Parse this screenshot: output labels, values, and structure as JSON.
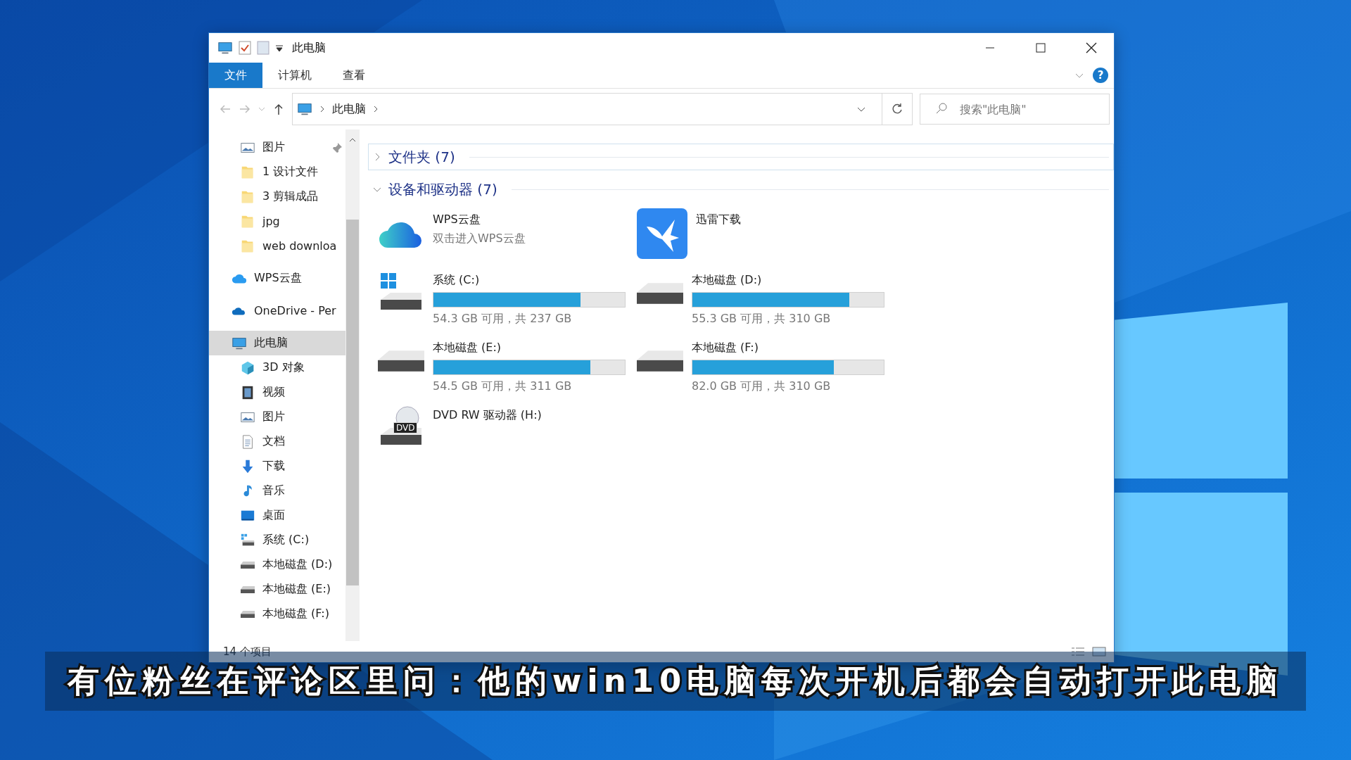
{
  "window": {
    "title": "此电脑"
  },
  "ribbon": {
    "tabs": [
      {
        "label": "文件",
        "selected": true
      },
      {
        "label": "计算机",
        "selected": false
      },
      {
        "label": "查看",
        "selected": false
      }
    ],
    "help": "?"
  },
  "address_bar": {
    "path": [
      "此电脑"
    ],
    "search_placeholder": "搜索\"此电脑\""
  },
  "sidebar": {
    "quick_access": [
      {
        "kind": "pictures",
        "label": "图片",
        "pinned": true,
        "selected": false
      },
      {
        "kind": "folder",
        "label": "1 设计文件",
        "pinned": false,
        "selected": false
      },
      {
        "kind": "folder",
        "label": "3 剪辑成品",
        "pinned": false,
        "selected": false
      },
      {
        "kind": "folder",
        "label": "jpg",
        "pinned": false,
        "selected": false
      },
      {
        "kind": "folder",
        "label": "web downloa",
        "pinned": false,
        "selected": false
      }
    ],
    "items": [
      {
        "kind": "wps",
        "label": "WPS云盘",
        "selected": false
      },
      {
        "kind": "onedrive",
        "label": "OneDrive - Per",
        "selected": false
      },
      {
        "kind": "pc",
        "label": "此电脑",
        "selected": true,
        "children": [
          {
            "kind": "cube",
            "label": "3D 对象",
            "selected": false
          },
          {
            "kind": "video",
            "label": "视频",
            "selected": false
          },
          {
            "kind": "pictures",
            "label": "图片",
            "selected": false
          },
          {
            "kind": "docs",
            "label": "文档",
            "selected": false
          },
          {
            "kind": "download",
            "label": "下载",
            "selected": false
          },
          {
            "kind": "music",
            "label": "音乐",
            "selected": false
          },
          {
            "kind": "desktop",
            "label": "桌面",
            "selected": false
          },
          {
            "kind": "sysdrive",
            "label": "系统 (C:)",
            "selected": false
          },
          {
            "kind": "drive",
            "label": "本地磁盘 (D:)",
            "selected": false
          },
          {
            "kind": "drive",
            "label": "本地磁盘 (E:)",
            "selected": false
          },
          {
            "kind": "drive",
            "label": "本地磁盘 (F:)",
            "selected": false
          }
        ]
      }
    ]
  },
  "sections": [
    {
      "title": "文件夹 (7)",
      "expanded": false
    },
    {
      "title": "设备和驱动器 (7)",
      "expanded": true,
      "items": [
        {
          "kind": "wps",
          "name": "WPS云盘",
          "subtitle": "双击进入WPS云盘"
        },
        {
          "kind": "xunlei",
          "name": "迅雷下载"
        },
        {
          "kind": "system-drive",
          "name": "系统 (C:)",
          "level": 0.77,
          "reading": "54.3 GB 可用，共 237 GB"
        },
        {
          "kind": "drive",
          "name": "本地磁盘 (D:)",
          "level": 0.82,
          "reading": "55.3 GB 可用，共 310 GB"
        },
        {
          "kind": "drive",
          "name": "本地磁盘 (E:)",
          "level": 0.82,
          "reading": "54.5 GB 可用，共 311 GB"
        },
        {
          "kind": "drive",
          "name": "本地磁盘 (F:)",
          "level": 0.74,
          "reading": "82.0 GB 可用，共 310 GB"
        },
        {
          "kind": "dvd",
          "name": "DVD RW 驱动器 (H:)",
          "badge": "DVD"
        }
      ]
    }
  ],
  "status_bar": {
    "count": "14 个项目"
  },
  "caption": "有位粉丝在评论区里问：他的win10电脑每次开机后都会自动打开此电脑"
}
